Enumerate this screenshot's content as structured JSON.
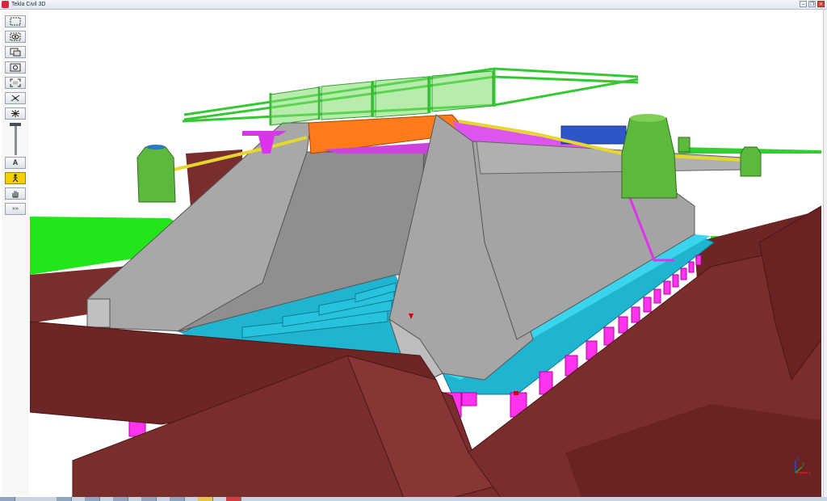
{
  "window": {
    "title": "Tekla Civil 3D",
    "controls": [
      "minimize",
      "restore",
      "close"
    ]
  },
  "toolbar": {
    "tools": [
      {
        "name": "select-rectangle-icon",
        "label": ""
      },
      {
        "name": "view-eye-icon",
        "label": ""
      },
      {
        "name": "view-select-icon",
        "label": ""
      },
      {
        "name": "zoom-rotate-icon",
        "label": ""
      },
      {
        "name": "fit-all-icon",
        "label": ""
      },
      {
        "name": "clip-plane-icon",
        "label": ""
      },
      {
        "name": "explode-icon",
        "label": ""
      },
      {
        "name": "text-tool",
        "label": "A"
      },
      {
        "name": "pan-person-icon",
        "label": ""
      },
      {
        "name": "hand-pan-icon",
        "label": ""
      },
      {
        "name": "more-tools",
        "label": "»»"
      }
    ],
    "active_tool": "pan-person-icon"
  },
  "viewport": {
    "axes": {
      "x": "x",
      "y": "y",
      "z": "z"
    },
    "colors": {
      "terrain": "#7a2d2d",
      "terrain_dark": "#5e2020",
      "grass": "#22e61a",
      "concrete": "#aaaaaa",
      "concrete_dark": "#8f8f8f",
      "deck": "#1fb4cf",
      "piles": "#ff33ee",
      "railing": "#33c933",
      "beam_orange": "#ff7a1a",
      "pipe_yellow": "#e6d630",
      "column_green": "#59b33a",
      "blue_box": "#2f56c8"
    }
  }
}
